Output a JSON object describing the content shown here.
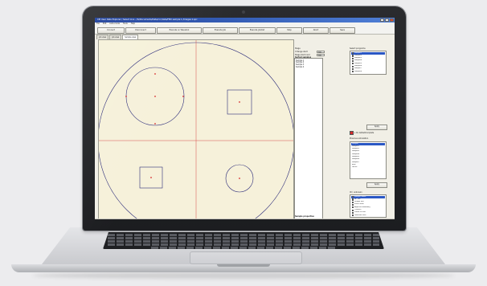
{
  "app": {
    "title": "CPI User Data Explorer / Select Ions - /fs/Documents/Data/ccc/data/FMX sample 1 /Images 1.spc"
  },
  "menu": [
    "File",
    "Edit",
    "Auto-mode",
    "Tools",
    "Help"
  ],
  "toolbar": {
    "buttons": [
      "Connect",
      "Disconnect",
      "Execute on Wavelink",
      "Execute Job",
      "Execute Job/list",
      "Stop",
      "Abort",
      "Save"
    ]
  },
  "tabs": [
    "Job view",
    "Job view",
    "Sample view"
  ],
  "info": {
    "rows": [
      {
        "label": "Stage",
        "value": ""
      },
      {
        "label": "X Range start",
        "value": "700"
      },
      {
        "label": "Stage start rand",
        "value": "700"
      }
    ],
    "list_heading": "Sorted samples",
    "list_items": [
      "Sample 1",
      "Sample 2",
      "Sample 3",
      "Sample 4"
    ],
    "footer_label": "Sample properties"
  },
  "right_panel": {
    "groups_heading": "Select programs",
    "groups": [
      "Sample1",
      "Sample2",
      "Sample3",
      "Sample4",
      "Sample5",
      "Sample6",
      "Sample7",
      "Sample8"
    ],
    "group_colors": [
      "#2a57c4",
      "#d06ad0",
      "#d8d06a",
      "#6ad8d0",
      "#e08a3a",
      "#4ac24a",
      "#d84a4a",
      "#6a6ad8"
    ],
    "apply_label": "Apply",
    "checkbox_label": "+ Do All/Set/Complete",
    "list2_heading": "Previous simulation",
    "list2": [
      "Sample",
      "Sample1",
      "Sample2",
      "Sample3",
      "Sample4",
      "Sample5",
      "Sample6",
      "Sample7",
      "Blue",
      "Green"
    ],
    "apply2_label": "Apply",
    "list3_heading": "ID / unknown",
    "list3": [
      "Sample name",
      "INT ion",
      "Unique N/D",
      "Inline issue",
      "Adjacent boundary",
      "Clusters",
      "Linear fit info",
      "Gaussian ions"
    ],
    "list3_colors": [
      "#2a57c4",
      "#f3c0c0",
      "#f3c0c0",
      "#f3c0c0",
      "#f3c0c0",
      "#f3c0c0",
      "#f3c0c0",
      "#f3c0c0"
    ]
  }
}
